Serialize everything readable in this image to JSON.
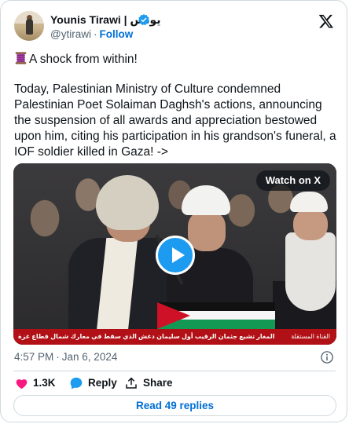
{
  "author": {
    "name": "Younis Tirawi | يونس",
    "handle": "@ytirawi",
    "follow_label": "Follow",
    "separator": "·"
  },
  "tweet": {
    "headline": "A shock from within!",
    "body": "Today, Palestinian Ministry of Culture condemned Palestinian Poet Solaiman Daghsh's actions, announcing the suspension of all awards and appreciation bestowed upon him, citing his participation in his grandson's funeral, a IOF soldier killed in Gaza! ->"
  },
  "media": {
    "watch_label": "Watch on X",
    "ticker_left": "المغار تشيع جثمان الرقيب أول سليمان دغش الذي سقط في معارك شمال قطاع غزة",
    "ticker_right": "القناة المستقلة"
  },
  "meta": {
    "time": "4:57 PM",
    "date": "Jan 6, 2024"
  },
  "actions": {
    "likes": "1.3K",
    "reply_label": "Reply",
    "share_label": "Share"
  },
  "footer": {
    "read_replies": "Read 49 replies"
  },
  "colors": {
    "accent": "#1d9bf0",
    "link": "#006fd6",
    "like": "#f91880",
    "text": "#0f1419",
    "muted": "#536471",
    "border": "#cfd9de"
  },
  "icons": [
    "spool-of-thread-emoji",
    "verified-badge-icon",
    "x-logo-icon",
    "play-icon",
    "info-icon",
    "heart-icon",
    "reply-bubble-icon",
    "share-icon"
  ]
}
